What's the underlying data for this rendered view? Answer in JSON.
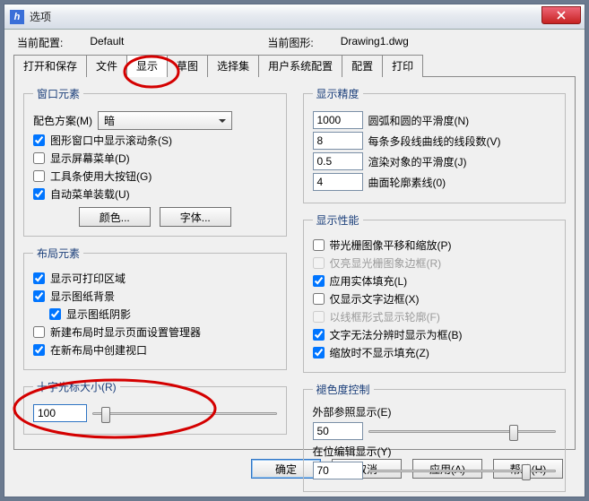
{
  "window": {
    "title": "选项"
  },
  "header": {
    "config_label": "当前配置:",
    "config_value": "Default",
    "drawing_label": "当前图形:",
    "drawing_value": "Drawing1.dwg"
  },
  "tabs": [
    "打开和保存",
    "文件",
    "显示",
    "草图",
    "选择集",
    "用户系统配置",
    "配置",
    "打印"
  ],
  "left": {
    "window_elements": {
      "legend": "窗口元素",
      "color_scheme_label": "配色方案(M)",
      "color_scheme_value": "暗",
      "scrollbars": "图形窗口中显示滚动条(S)",
      "screen_menu": "显示屏幕菜单(D)",
      "big_buttons": "工具条使用大按钮(G)",
      "auto_menu": "自动菜单装载(U)",
      "color_btn": "颜色...",
      "font_btn": "字体..."
    },
    "layout_elements": {
      "legend": "布局元素",
      "print_area": "显示可打印区域",
      "paper_bg": "显示图纸背景",
      "paper_shadow": "显示图纸阴影",
      "page_setup": "新建布局时显示页面设置管理器",
      "create_vp": "在新布局中创建视口"
    },
    "crosshair": {
      "legend": "十字光标大小(R)",
      "value": "100"
    }
  },
  "right": {
    "precision": {
      "legend": "显示精度",
      "arc": {
        "value": "1000",
        "label": "圆弧和圆的平滑度(N)"
      },
      "polyline": {
        "value": "8",
        "label": "每条多段线曲线的线段数(V)"
      },
      "render": {
        "value": "0.5",
        "label": "渲染对象的平滑度(J)"
      },
      "contour": {
        "value": "4",
        "label": "曲面轮廓素线(0)"
      }
    },
    "performance": {
      "legend": "显示性能",
      "pan_zoom": "带光栅图像平移和缩放(P)",
      "highlight": "仅亮显光栅图象边框(R)",
      "solid_fill": "应用实体填充(L)",
      "text_frame": "仅显示文字边框(X)",
      "wire_outline": "以线框形式显示轮廓(F)",
      "true_color": "文字无法分辨时显示为框(B)",
      "no_fill_zoom": "缩放时不显示填充(Z)"
    },
    "fade": {
      "legend": "褪色度控制",
      "xref_label": "外部参照显示(E)",
      "xref_value": "50",
      "inplace_label": "在位编辑显示(Y)",
      "inplace_value": "70"
    }
  },
  "buttons": {
    "ok": "确定",
    "cancel": "取消",
    "apply": "应用(A)",
    "help": "帮助(H)"
  }
}
